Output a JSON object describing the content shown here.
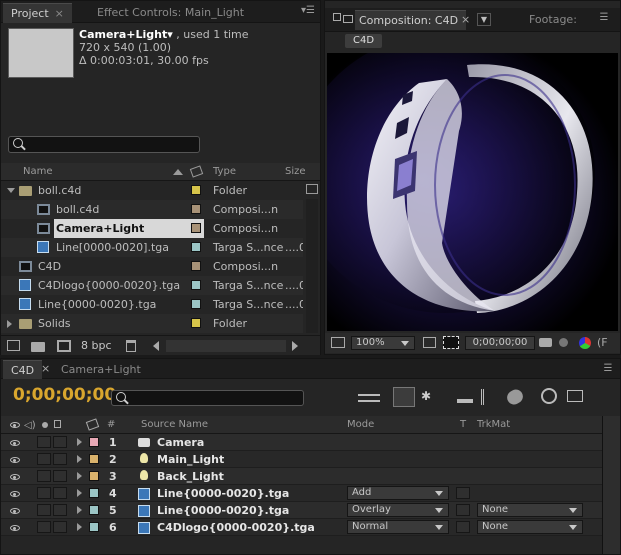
{
  "project_panel": {
    "tabs": [
      {
        "label": "Project",
        "close": "×"
      },
      {
        "label": "Effect Controls: Main_Light"
      }
    ],
    "item_name": "Camera+Light▾",
    "used_text": ", used 1 time",
    "dims": "720 x 540 (1.00)",
    "duration": "Δ 0:00:03:01, 30.00 fps",
    "columns": {
      "name": "Name",
      "type": "Type",
      "size": "Size"
    },
    "items": [
      {
        "name": "boll.c4d",
        "type": "Folder",
        "size": "",
        "label_color": "#d6c44a",
        "icon": "folder-icon",
        "indent": 0,
        "expanded": true
      },
      {
        "name": "boll.c4d",
        "type": "Composi...n",
        "size": "",
        "label_color": "#a89277",
        "icon": "composition-icon",
        "indent": 1
      },
      {
        "name": "Camera+Light",
        "type": "Composi...n",
        "size": "",
        "label_color": "#a89277",
        "icon": "composition-icon",
        "indent": 1,
        "selected": true
      },
      {
        "name": "Line[0000-0020].tga",
        "type": "Targa S...nce",
        "size": "....0",
        "label_color": "#9bc5c5",
        "icon": "tga-sequence-icon",
        "indent": 1
      },
      {
        "name": "C4D",
        "type": "Composi...n",
        "size": "",
        "label_color": "#a89277",
        "icon": "composition-icon",
        "indent": 0
      },
      {
        "name": "C4Dlogo{0000-0020}.tga",
        "type": "Targa S...nce",
        "size": "....0",
        "label_color": "#9bc5c5",
        "icon": "tga-sequence-icon",
        "indent": 0
      },
      {
        "name": "Line{0000-0020}.tga",
        "type": "Targa S...nce",
        "size": "....0",
        "label_color": "#9bc5c5",
        "icon": "tga-sequence-icon",
        "indent": 0
      },
      {
        "name": "Solids",
        "type": "Folder",
        "size": "",
        "label_color": "#d6c44a",
        "icon": "folder-icon",
        "indent": 0,
        "expanded": false
      }
    ],
    "bpc": "8 bpc"
  },
  "comp_panel": {
    "tab_label": "Composition: C4D",
    "footage_tab": "Footage:",
    "comp_button": "C4D",
    "zoom": "100%",
    "timecode": "0;00;00;00",
    "extra": "(F"
  },
  "timeline": {
    "tabs": [
      {
        "label": "C4D"
      },
      {
        "label": "Camera+Light"
      }
    ],
    "timecode": "0;00;00;00",
    "columns": {
      "num": "#",
      "source": "Source Name",
      "mode": "Mode",
      "t": "T",
      "trkmat": "TrkMat"
    },
    "layers": [
      {
        "num": "1",
        "name": "Camera",
        "color": "#e7a8b5",
        "icon": "camera-icon",
        "mode": "",
        "trkmat": ""
      },
      {
        "num": "2",
        "name": "Main_Light",
        "color": "#d9b26c",
        "icon": "light-icon",
        "mode": "",
        "trkmat": ""
      },
      {
        "num": "3",
        "name": "Back_Light",
        "color": "#d9b26c",
        "icon": "light-icon",
        "mode": "",
        "trkmat": ""
      },
      {
        "num": "4",
        "name": "Line{0000-0020}.tga",
        "color": "#9bc5c5",
        "icon": "tga-sequence-icon",
        "mode": "Add",
        "trkmat": ""
      },
      {
        "num": "5",
        "name": "Line{0000-0020}.tga",
        "color": "#9bc5c5",
        "icon": "tga-sequence-icon",
        "mode": "Overlay",
        "trkmat": "None"
      },
      {
        "num": "6",
        "name": "C4Dlogo{0000-0020}.tga",
        "color": "#9bc5c5",
        "icon": "tga-sequence-icon",
        "mode": "Normal",
        "trkmat": "None"
      }
    ]
  }
}
